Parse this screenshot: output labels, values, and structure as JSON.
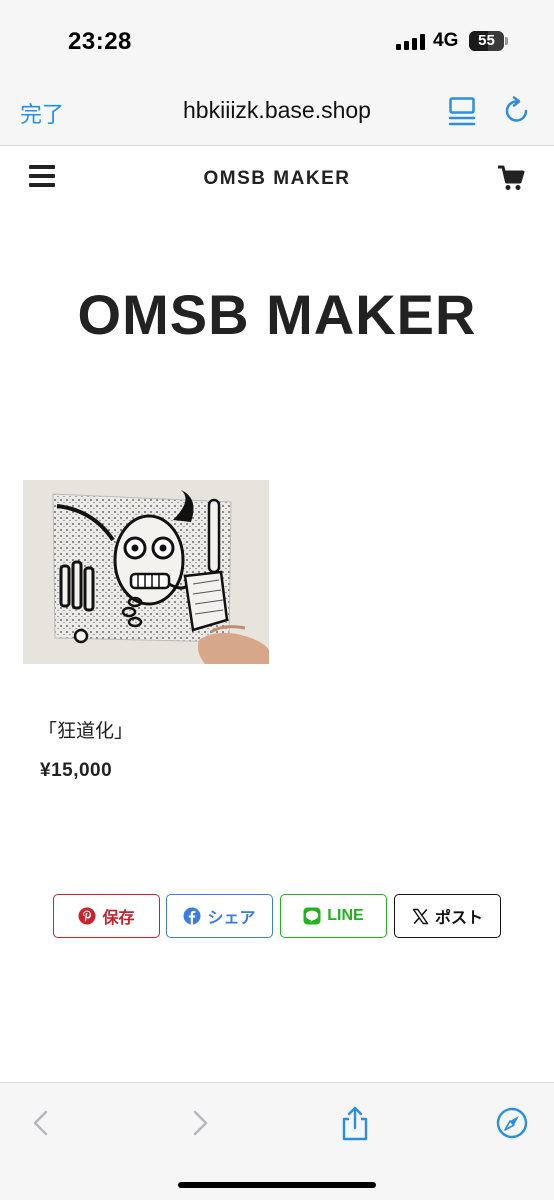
{
  "status_bar": {
    "time": "23:28",
    "network": "4G",
    "battery_level": "55",
    "battery_fraction": 0.55,
    "icons": [
      "signal-bars-icon",
      "battery-icon"
    ]
  },
  "browser": {
    "done_label": "完了",
    "url": "hbkiiizk.base.shop",
    "accent_color": "#2a8fe0",
    "top_icons": [
      "reader-view-icon",
      "reload-icon"
    ],
    "bottom_icons": [
      "back-icon",
      "forward-icon",
      "share-icon",
      "safari-compass-icon"
    ]
  },
  "site_header": {
    "title": "OMSB MAKER",
    "icons": [
      "hamburger-menu-icon",
      "cart-icon"
    ]
  },
  "hero": {
    "logo_text": "OMSB MAKER"
  },
  "product": {
    "name": "「狂道化」",
    "price": "¥15,000",
    "image": "artwork-photo"
  },
  "share": {
    "buttons": [
      {
        "label": "保存",
        "icon": "pinterest-icon",
        "color": "#c8232c"
      },
      {
        "label": "シェア",
        "icon": "facebook-icon",
        "color": "#3b7ddd"
      },
      {
        "label": "LINE",
        "icon": "line-icon",
        "color": "#22b11f"
      },
      {
        "label": "ポスト",
        "icon": "x-icon",
        "color": "#111111"
      }
    ]
  }
}
